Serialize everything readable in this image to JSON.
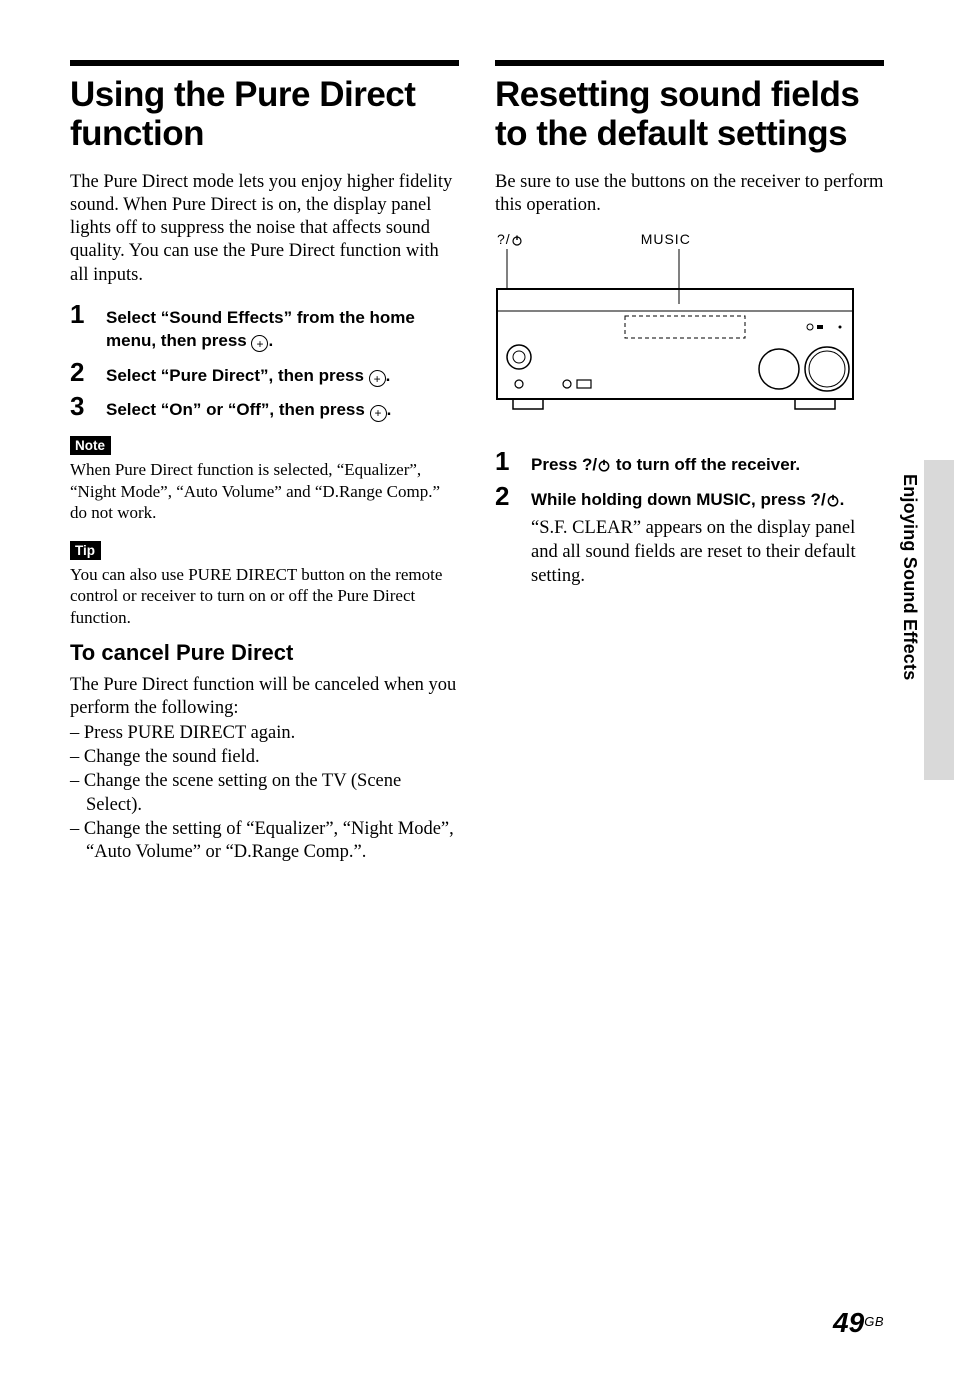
{
  "left": {
    "title": "Using the Pure Direct function",
    "intro": "The Pure Direct mode lets you enjoy higher fidelity sound. When Pure Direct is on, the display panel lights off to suppress the noise that affects sound quality. You can use the Pure Direct function with all inputs.",
    "steps": [
      {
        "num": "1",
        "pre": "Select “Sound Effects” from the home menu, then press ",
        "post": "."
      },
      {
        "num": "2",
        "pre": "Select “Pure Direct”, then press ",
        "post": "."
      },
      {
        "num": "3",
        "pre": "Select “On” or “Off”,  then press ",
        "post": "."
      }
    ],
    "note_label": "Note",
    "note_body": "When Pure Direct function is selected, “Equalizer”, “Night Mode”, “Auto Volume” and “D.Range Comp.” do not work.",
    "tip_label": "Tip",
    "tip_body": "You can also use PURE DIRECT button on the remote control or receiver to turn on or off the Pure Direct function.",
    "h2": "To cancel Pure Direct",
    "cancel_intro": "The Pure Direct function will be canceled when you perform the following:",
    "dash": [
      "– Press PURE DIRECT again.",
      "– Change the sound field.",
      "– Change the scene setting on the TV (Scene Select).",
      "– Change the setting of “Equalizer”, “Night Mode”, “Auto Volume” or “D.Range Comp.”."
    ]
  },
  "right": {
    "title": "Resetting sound fields to the default settings",
    "intro": "Be sure to use the buttons on the receiver to perform this operation.",
    "labels": {
      "power": "?/",
      "music": "MUSIC"
    },
    "steps": [
      {
        "num": "1",
        "pre": "Press ?/",
        "post": " to turn off the receiver."
      },
      {
        "num": "2",
        "pre": "While holding down MUSIC, press ?/",
        "post": ".",
        "sub": "“S.F. CLEAR” appears on the display panel and all sound fields are reset to their default setting."
      }
    ]
  },
  "sidebar": "Enjoying Sound Effects",
  "page": {
    "num": "49",
    "suffix": "GB"
  },
  "icons": {
    "plus": "+"
  }
}
